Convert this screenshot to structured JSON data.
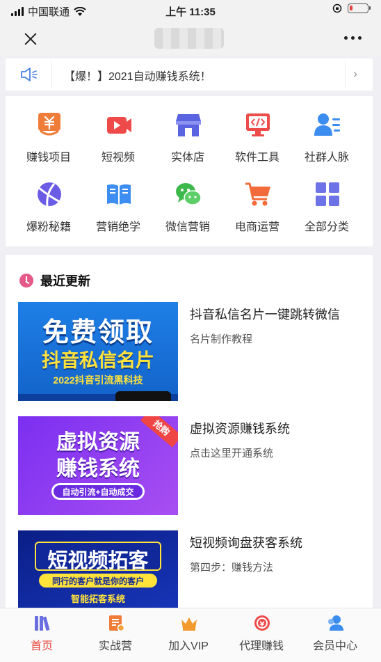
{
  "status_bar": {
    "carrier": "中国联通",
    "time": "上午 11:35"
  },
  "notice": {
    "text": "【爆！】2021自动赚钱系统！"
  },
  "categories": [
    {
      "label": "赚钱项目",
      "icon": "money-bag-icon",
      "color": "#f07c3a"
    },
    {
      "label": "短视频",
      "icon": "video-camera-icon",
      "color": "#ef4a4a"
    },
    {
      "label": "实体店",
      "icon": "storefront-icon",
      "color": "#5a63e0"
    },
    {
      "label": "软件工具",
      "icon": "code-monitor-icon",
      "color": "#ee4b4b"
    },
    {
      "label": "社群人脉",
      "icon": "contacts-icon",
      "color": "#3b8df0"
    },
    {
      "label": "爆粉秘籍",
      "icon": "planet-icon",
      "color": "#6b5ce6"
    },
    {
      "label": "营销绝学",
      "icon": "book-icon",
      "color": "#3d8ef0"
    },
    {
      "label": "微信营销",
      "icon": "wechat-icon",
      "color": "#3cb94a"
    },
    {
      "label": "电商运营",
      "icon": "shopping-cart-icon",
      "color": "#f26b3a"
    },
    {
      "label": "全部分类",
      "icon": "grid-icon",
      "color": "#6d73e6"
    }
  ],
  "recent": {
    "title": "最近更新",
    "articles": [
      {
        "title": "抖音私信名片一键跳转微信",
        "subtitle": "名片制作教程",
        "thumb_lines": [
          "免费领取",
          "抖音私信名片",
          "2022抖音引流黑科技"
        ]
      },
      {
        "title": "虚拟资源赚钱系统",
        "subtitle": "点击这里开通系统",
        "thumb_lines": [
          "虚拟资源",
          "赚钱系统",
          "自动引流+自动成交",
          "抢购"
        ]
      },
      {
        "title": "短视频询盘获客系统",
        "subtitle": "第四步：赚钱方法",
        "thumb_lines": [
          "短视频拓客",
          "同行的客户就是你的客户",
          "智能拓客系统"
        ]
      }
    ]
  },
  "tabs": [
    {
      "label": "首页",
      "icon": "books-icon",
      "active": true
    },
    {
      "label": "实战营",
      "icon": "notebook-icon",
      "active": false
    },
    {
      "label": "加入VIP",
      "icon": "crown-icon",
      "active": false
    },
    {
      "label": "代理赚钱",
      "icon": "agent-coin-icon",
      "active": false
    },
    {
      "label": "会员中心",
      "icon": "members-icon",
      "active": false
    }
  ]
}
